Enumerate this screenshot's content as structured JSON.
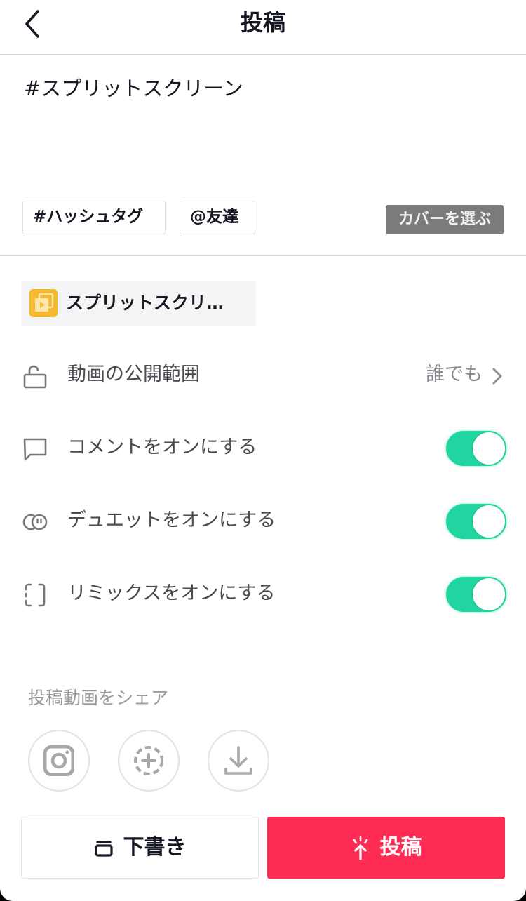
{
  "header": {
    "title": "投稿",
    "back_icon": "chevron-left-icon"
  },
  "caption": {
    "text": "#スプリットスクリーン"
  },
  "chips": {
    "hashtag": "#ハッシュタグ",
    "friend": "@友達"
  },
  "cover_button": "カバーを選ぶ",
  "effect": {
    "label": "スプリットスクリ…",
    "icon": "effect-split-screen-icon",
    "icon_color": "#f4b92f"
  },
  "settings": {
    "privacy": {
      "icon": "unlock-icon",
      "label": "動画の公開範囲",
      "value": "誰でも"
    },
    "comments": {
      "icon": "comment-icon",
      "label": "コメントをオンにする",
      "enabled": true
    },
    "duet": {
      "icon": "duet-icon",
      "label": "デュエットをオンにする",
      "enabled": true
    },
    "remix": {
      "icon": "remix-icon",
      "label": "リミックスをオンにする",
      "enabled": true
    }
  },
  "share": {
    "title": "投稿動画をシェア",
    "targets": [
      {
        "name": "instagram",
        "icon": "instagram-icon"
      },
      {
        "name": "story",
        "icon": "add-story-icon"
      },
      {
        "name": "save",
        "icon": "download-icon"
      }
    ]
  },
  "actions": {
    "draft_label": "下書き",
    "post_label": "投稿"
  },
  "colors": {
    "accent": "#fe2c55",
    "toggle_on": "#20d5a0",
    "cover_button": "#7b7b7b"
  }
}
